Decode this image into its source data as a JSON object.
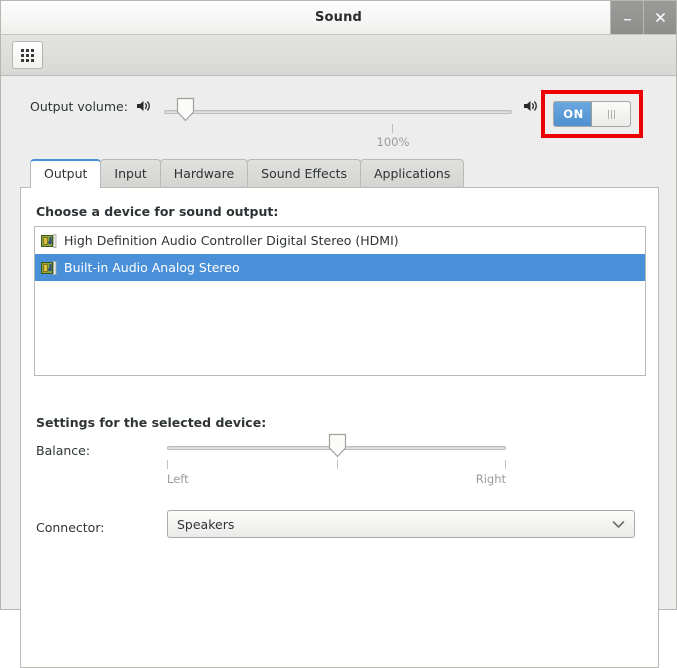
{
  "window": {
    "title": "Sound",
    "buttons": {
      "minimize": "minimize",
      "close": "close"
    }
  },
  "toolbar": {
    "apps_button": "all-settings"
  },
  "volume": {
    "label": "Output volume:",
    "value_label": "100%",
    "slider_position_pct": 6,
    "mute_icon_left": "speaker-icon",
    "mute_icon_right": "speaker-icon",
    "toggle": {
      "state_label": "ON",
      "enabled": true,
      "highlight_color": "#ee0000"
    }
  },
  "tabs": [
    {
      "label": "Output",
      "active": true
    },
    {
      "label": "Input",
      "active": false
    },
    {
      "label": "Hardware",
      "active": false
    },
    {
      "label": "Sound Effects",
      "active": false
    },
    {
      "label": "Applications",
      "active": false
    }
  ],
  "output_tab": {
    "devices_heading": "Choose a device for sound output:",
    "devices": [
      {
        "name": "High Definition Audio Controller Digital Stereo (HDMI)",
        "selected": false
      },
      {
        "name": "Built-in Audio Analog Stereo",
        "selected": true
      }
    ],
    "settings_heading": "Settings for the selected device:",
    "balance": {
      "label": "Balance:",
      "left_label": "Left",
      "right_label": "Right",
      "position_pct": 50
    },
    "connector": {
      "label": "Connector:",
      "value": "Speakers"
    }
  },
  "colors": {
    "selection_blue": "#4a90d9",
    "toggle_blue": "#4e90d0",
    "highlight_red": "#ee0000"
  }
}
